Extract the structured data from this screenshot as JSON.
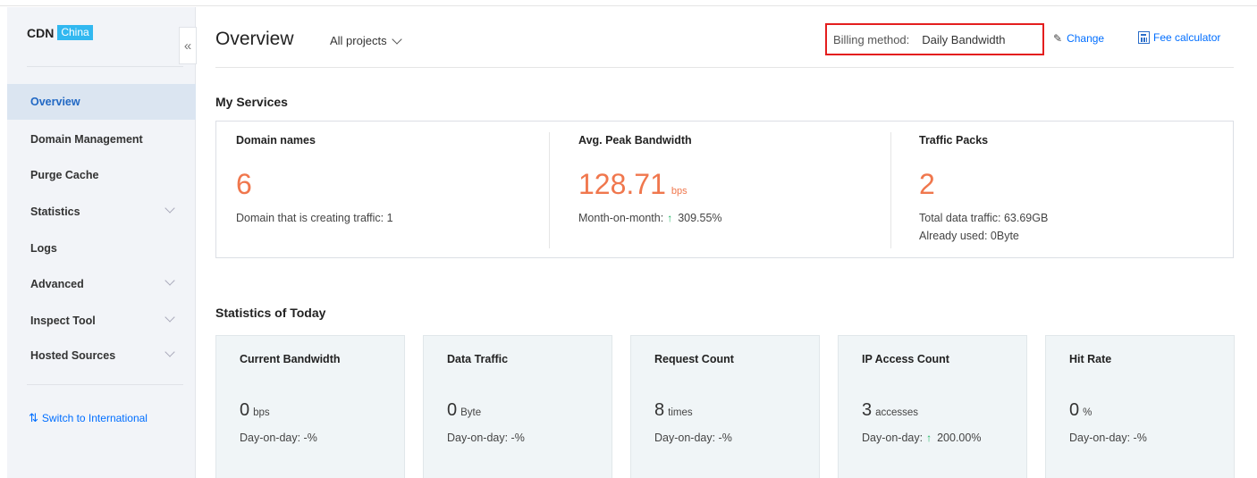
{
  "brand": {
    "name": "CDN",
    "badge": "China"
  },
  "sidebar": {
    "collapse_glyph": "«",
    "items": [
      {
        "label": "Overview",
        "active": true,
        "has_chevron": false
      },
      {
        "label": "Domain Management",
        "active": false,
        "has_chevron": false
      },
      {
        "label": "Purge Cache",
        "active": false,
        "has_chevron": false
      },
      {
        "label": "Statistics",
        "active": false,
        "has_chevron": true
      },
      {
        "label": "Logs",
        "active": false,
        "has_chevron": false
      },
      {
        "label": "Advanced",
        "active": false,
        "has_chevron": true
      },
      {
        "label": "Inspect Tool",
        "active": false,
        "has_chevron": true
      },
      {
        "label": "Hosted Sources",
        "active": false,
        "has_chevron": true
      }
    ],
    "switch_link": "Switch to International",
    "switch_icon": "switch-arrows-icon"
  },
  "header": {
    "title": "Overview",
    "project_select": "All projects",
    "billing_label": "Billing method:",
    "billing_value": "Daily Bandwidth",
    "change_label": "Change",
    "fee_label": "Fee calculator"
  },
  "services": {
    "title": "My Services",
    "domain": {
      "title": "Domain names",
      "value": "6",
      "sub": "Domain that is creating traffic: 1"
    },
    "bandwidth": {
      "title": "Avg. Peak Bandwidth",
      "value": "128.71",
      "unit": "bps",
      "sub_prefix": "Month-on-month:",
      "arrow": "↑",
      "sub_value": "309.55%"
    },
    "packs": {
      "title": "Traffic Packs",
      "value": "2",
      "sub": "Total data traffic: 63.69GB",
      "sub2": "Already used: 0Byte"
    }
  },
  "today": {
    "title": "Statistics of Today",
    "cards": [
      {
        "title": "Current Bandwidth",
        "value": "0",
        "unit": "bps",
        "sub": "Day-on-day: -%"
      },
      {
        "title": "Data Traffic",
        "value": "0",
        "unit": "Byte",
        "sub": "Day-on-day: -%"
      },
      {
        "title": "Request Count",
        "value": "8",
        "unit": "times",
        "sub": "Day-on-day: -%"
      },
      {
        "title": "IP Access Count",
        "value": "3",
        "unit": "accesses",
        "sub_prefix": "Day-on-day:",
        "arrow": "↑",
        "sub_value": "200.00%"
      },
      {
        "title": "Hit Rate",
        "value": "0",
        "unit": "%",
        "sub": "Day-on-day: -%"
      }
    ]
  },
  "colors": {
    "accent": "#006eff",
    "highlight": "#f0774d",
    "up": "#1db561",
    "billing_box": "#e41e1e"
  }
}
